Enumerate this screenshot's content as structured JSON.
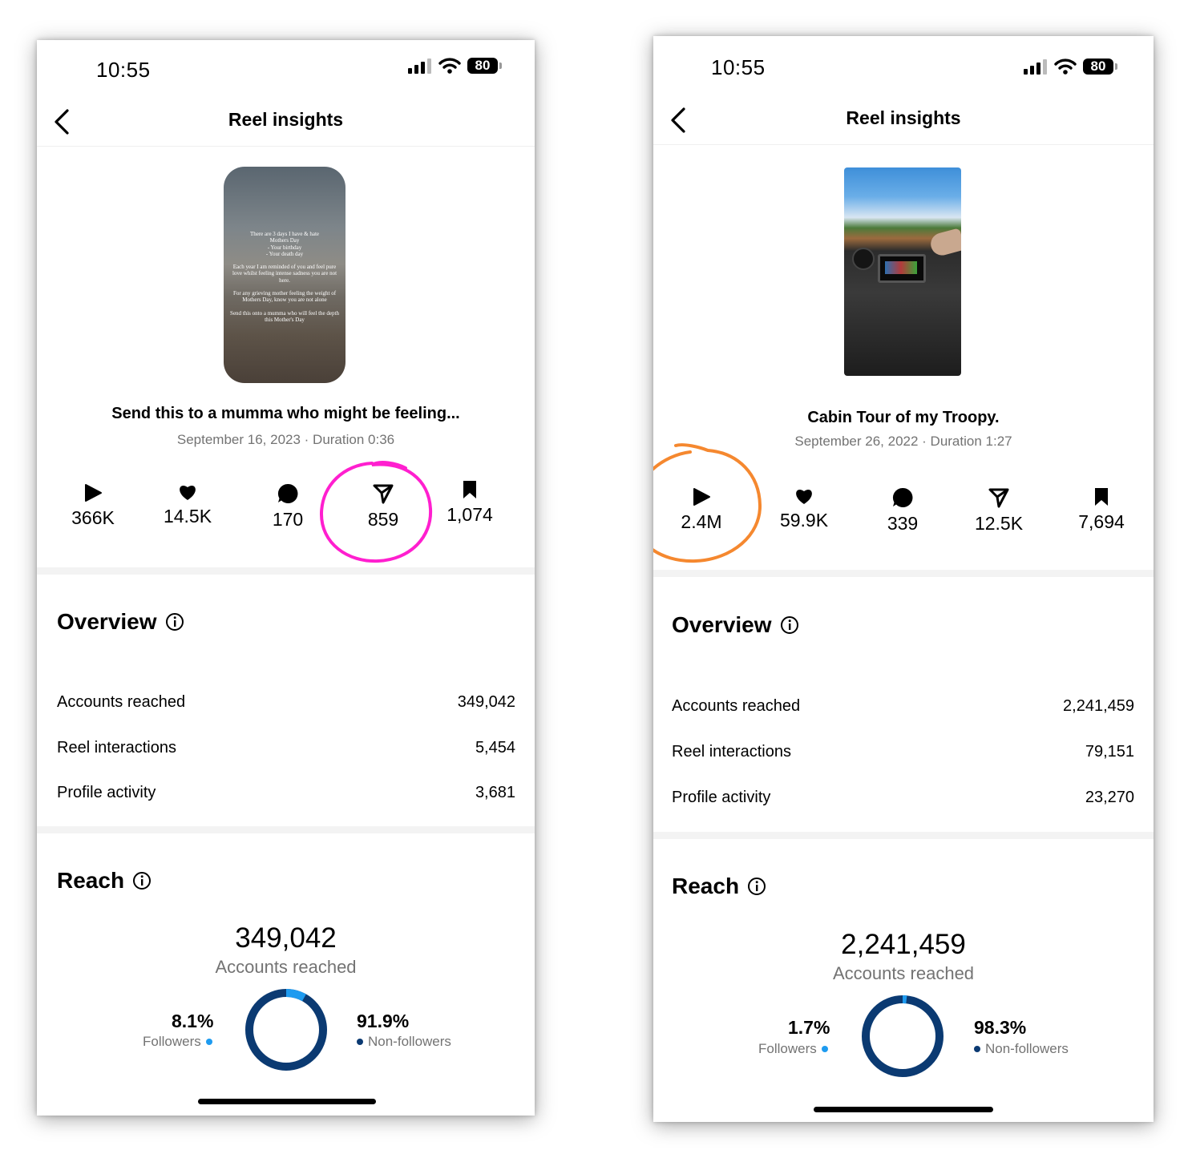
{
  "left": {
    "status": {
      "time": "10:55",
      "battery": "80"
    },
    "nav": {
      "title": "Reel insights"
    },
    "reel": {
      "thumbnail_text": [
        "There are 3 days I have & hate",
        "Mothers Day",
        "- Your birthday",
        "- Your death day",
        "Each year I am reminded of you and feel pure",
        "love whilst feeling intense sadness you are not",
        "here.",
        "For any grieving mother feeling the weight of",
        "Mothers Day, know you are not alone",
        "Send this onto a mumma who will feel the depth",
        "this Mother's Day"
      ],
      "title": "Send this to a mumma who might be feeling...",
      "meta": "September 16, 2023 · Duration 0:36"
    },
    "metrics": {
      "plays": "366K",
      "likes": "14.5K",
      "comments": "170",
      "shares": "859",
      "saves": "1,074"
    },
    "overview": {
      "title": "Overview",
      "rows": [
        {
          "label": "Accounts reached",
          "value": "349,042"
        },
        {
          "label": "Reel interactions",
          "value": "5,454"
        },
        {
          "label": "Profile activity",
          "value": "3,681"
        }
      ]
    },
    "reach": {
      "title": "Reach",
      "total": "349,042",
      "total_label": "Accounts reached",
      "followers_pct": "8.1%",
      "followers_label": "Followers",
      "nonfollowers_pct": "91.9%",
      "nonfollowers_label": "Non-followers",
      "followers_fraction": 0.081
    },
    "highlight_color": "#ff1fcf"
  },
  "right": {
    "status": {
      "time": "10:55",
      "battery": "80"
    },
    "nav": {
      "title": "Reel insights"
    },
    "reel": {
      "title": "Cabin Tour of my Troopy.",
      "meta": "September 26, 2022 · Duration 1:27"
    },
    "metrics": {
      "plays": "2.4M",
      "likes": "59.9K",
      "comments": "339",
      "shares": "12.5K",
      "saves": "7,694"
    },
    "overview": {
      "title": "Overview",
      "rows": [
        {
          "label": "Accounts reached",
          "value": "2,241,459"
        },
        {
          "label": "Reel interactions",
          "value": "79,151"
        },
        {
          "label": "Profile activity",
          "value": "23,270"
        }
      ]
    },
    "reach": {
      "title": "Reach",
      "total": "2,241,459",
      "total_label": "Accounts reached",
      "followers_pct": "1.7%",
      "followers_label": "Followers",
      "nonfollowers_pct": "98.3%",
      "nonfollowers_label": "Non-followers",
      "followers_fraction": 0.017
    },
    "highlight_color": "#f5882f"
  },
  "colors": {
    "followers": "#1e9bf0",
    "nonfollowers": "#0b3a72"
  }
}
